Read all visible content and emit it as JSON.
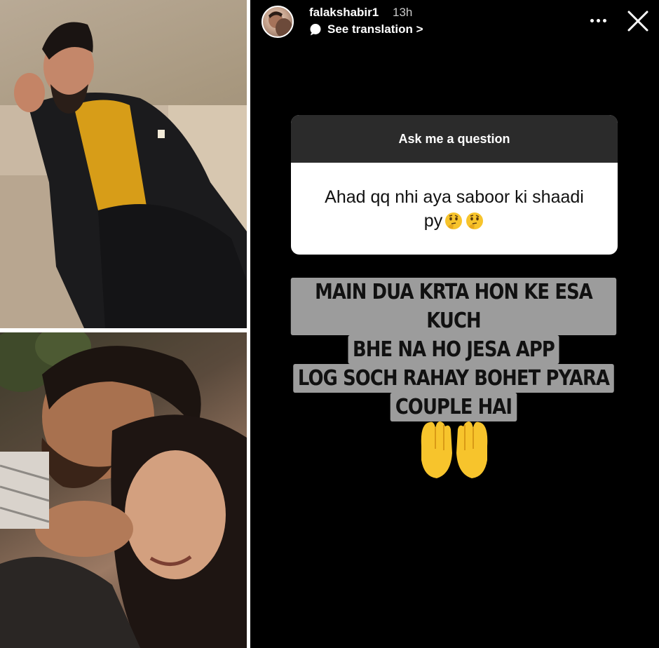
{
  "collage": {
    "photos": [
      {
        "name": "man-in-black-blazer-photo"
      },
      {
        "name": "couple-embrace-photo"
      }
    ]
  },
  "story": {
    "header": {
      "username": "falakshabir1",
      "timestamp": "13h",
      "see_translation": "See translation >"
    },
    "question_sticker": {
      "title": "Ask me a question",
      "question_text": "Ahad qq nhi aya saboor ki shaadi py"
    },
    "reply_caption": [
      "MAIN DUA KRTA HON KE ESA KUCH",
      "BHE NA HO JESA APP",
      "LOG SOCH RAHAY BOHET PYARA",
      "COUPLE HAI"
    ],
    "icons": {
      "more": "more-options-icon",
      "close": "close-icon",
      "translate": "speech-bubble-icon",
      "emoji_question": "thinking-face-emoji",
      "emoji_reply": "palms-up-together-emoji"
    },
    "colors": {
      "background": "#000000",
      "caption_highlight": "#9c9c9c",
      "sticker_header": "#2b2b2b",
      "emoji_yellow": "#f7c42c"
    }
  }
}
